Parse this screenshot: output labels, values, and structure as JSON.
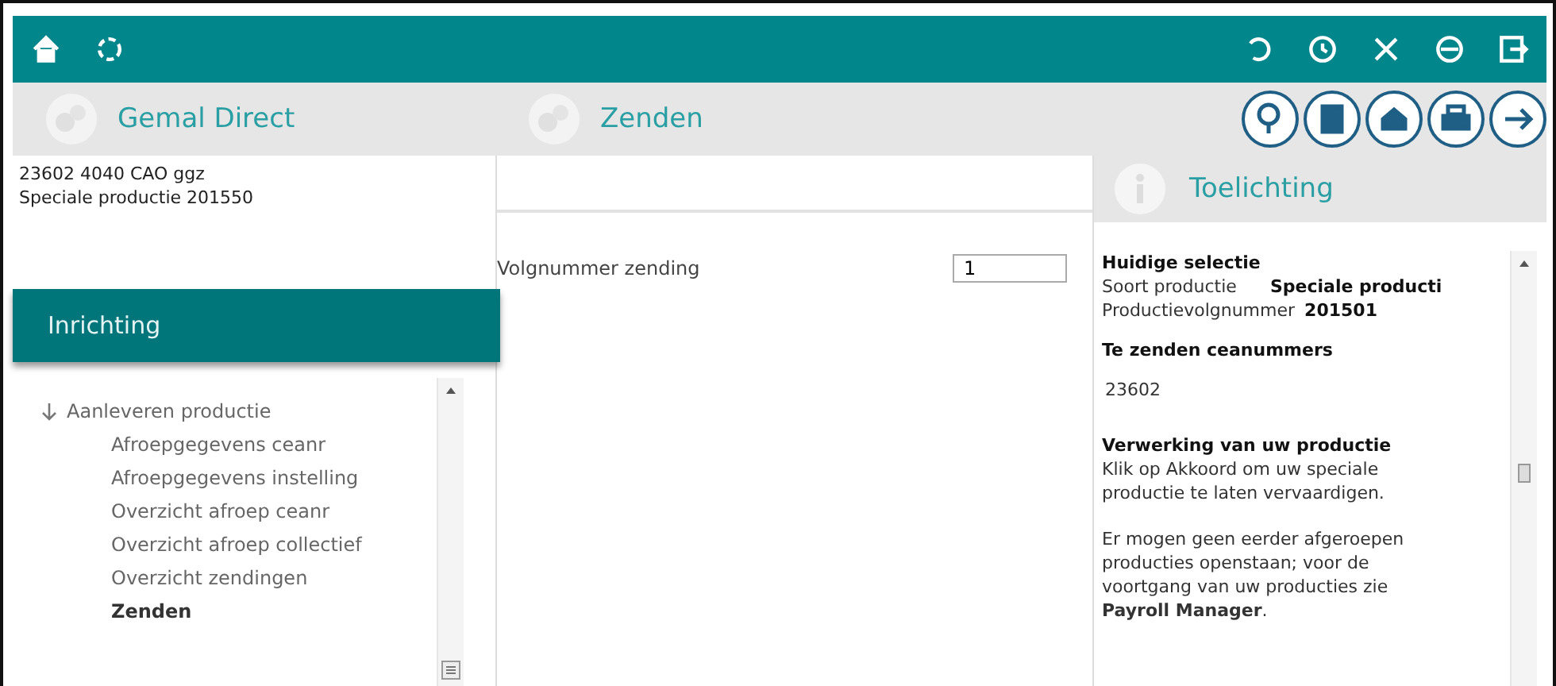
{
  "header": {
    "left_title": "Gemal Direct",
    "middle_title": "Zenden",
    "right_title": "Toelichting"
  },
  "selection": {
    "lines": [
      "23602 4040 CAO ggz",
      "Speciale productie  201550"
    ]
  },
  "section_bar": {
    "label": "Inrichting"
  },
  "tree": [
    {
      "label": "Aanleveren productie",
      "expanded": true,
      "selected": false,
      "children": [
        {
          "label": "Afroepgegevens ceanr",
          "selected": false
        },
        {
          "label": "Afroepgegevens instelling",
          "selected": false
        },
        {
          "label": "Overzicht afroep ceanr",
          "selected": false
        },
        {
          "label": "Overzicht afroep collectief",
          "selected": false
        },
        {
          "label": "Overzicht zendingen",
          "selected": false
        },
        {
          "label": "Zenden",
          "selected": true
        }
      ]
    }
  ],
  "form": {
    "label": "Volgnummer zending",
    "value": "1"
  },
  "info": {
    "heading1": "Huidige selectie",
    "rows": [
      {
        "label": "Soort productie",
        "value": "Speciale producti"
      },
      {
        "label": "Productievolgnummer",
        "value": "201501"
      }
    ],
    "heading2": "Te zenden ceanummers",
    "number": "23602",
    "heading3": "Verwerking van uw productie",
    "para1": "Klik op Akkoord om uw speciale productie te laten vervaardigen.",
    "para2": "Er mogen geen eerder afgeroepen producties openstaan; voor de voortgang van uw producties zie **Payroll Manager**."
  }
}
